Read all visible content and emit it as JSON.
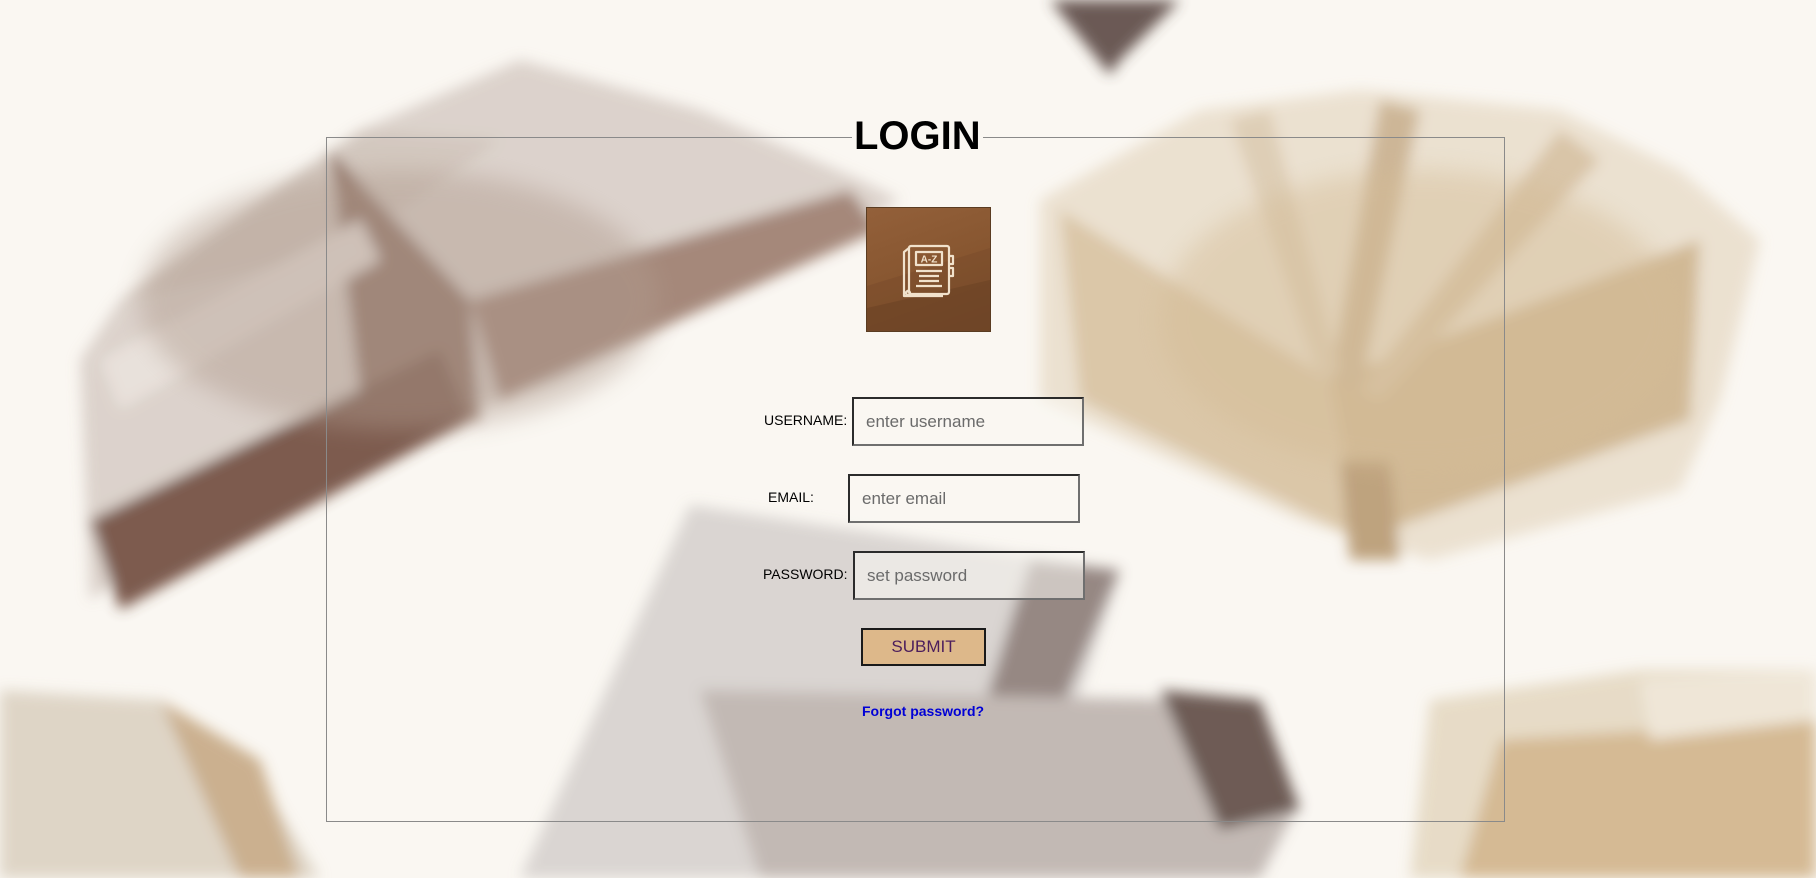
{
  "login": {
    "title": "LOGIN",
    "logo_icon": "book-a-z-icon",
    "logo_text": "A-Z",
    "fields": {
      "username": {
        "label": "USERNAME:",
        "placeholder": "enter username",
        "value": ""
      },
      "email": {
        "label": "EMAIL:",
        "placeholder": "enter email",
        "value": ""
      },
      "password": {
        "label": "PASSWORD:",
        "placeholder": "set password",
        "value": ""
      }
    },
    "submit_label": "SUBMIT",
    "forgot_label": "Forgot password?"
  },
  "colors": {
    "background": "#faf7f2",
    "logo_brown": "#86552f",
    "submit_bg": "#ddb88a",
    "submit_text": "#4b1d5c",
    "link": "#0000d6"
  }
}
